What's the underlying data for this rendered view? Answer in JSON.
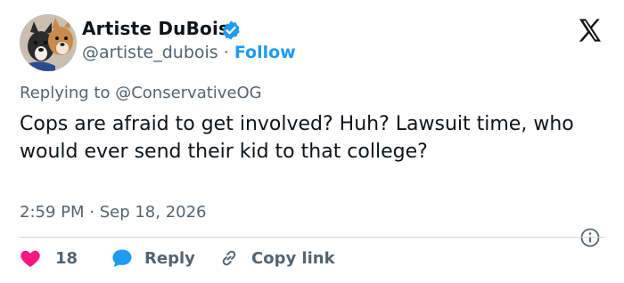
{
  "author": {
    "display_name": "Artiste DuBois",
    "handle": "@artiste_dubois",
    "separator": " · ",
    "follow_label": "Follow"
  },
  "reply_context": {
    "prefix": "Replying to ",
    "mention": "@ConservativeOG"
  },
  "tweet": {
    "text": "Cops are afraid to get involved? Huh? Lawsuit time, who would ever send their kid to that college?",
    "timestamp": "2:59 PM · Sep 18, 2026"
  },
  "actions": {
    "likes_count": "18",
    "reply_label": "Reply",
    "copy_link_label": "Copy link"
  },
  "colors": {
    "text": "#0f1419",
    "secondary": "#536471",
    "accent": "#1d9bf0",
    "like": "#f91880",
    "divider": "#cfd9de"
  },
  "icons": [
    "verified-badge-icon",
    "x-logo-icon",
    "info-icon",
    "heart-icon",
    "reply-bubble-icon",
    "link-icon"
  ]
}
